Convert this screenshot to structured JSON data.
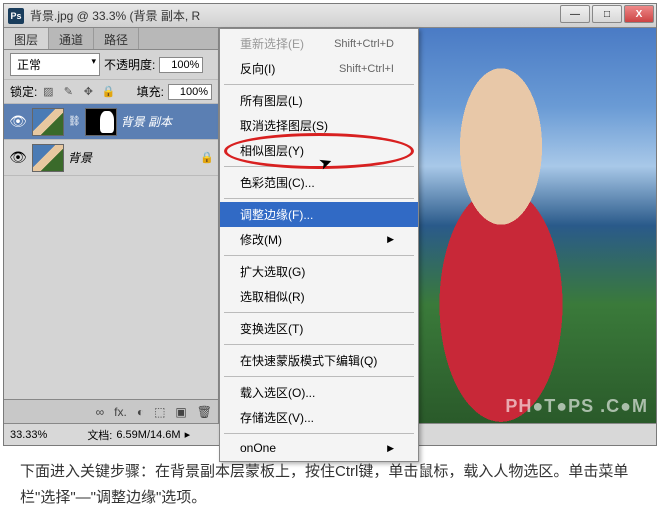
{
  "titlebar": {
    "ps_label": "Ps",
    "title": "背景.jpg @ 33.3% (背景 副本, R"
  },
  "win_controls": {
    "min": "—",
    "max": "□",
    "close": "X"
  },
  "panel": {
    "tabs": {
      "layers": "图层",
      "channels": "通道",
      "paths": "路径"
    },
    "blend_mode": "正常",
    "opacity_label": "不透明度:",
    "opacity_value": "100%",
    "lock_label": "锁定:",
    "fill_label": "填充:",
    "fill_value": "100%"
  },
  "layers": [
    {
      "name": "背景 副本",
      "visible": "👁"
    },
    {
      "name": "背景",
      "visible": "👁"
    }
  ],
  "panel_footer_icons": [
    "∞",
    "fx.",
    "◐",
    "⬚",
    "▣",
    "🗑"
  ],
  "menu": {
    "items": [
      {
        "label": "反向(I)",
        "shortcut": "Shift+Ctrl+I"
      },
      {
        "sep": true
      },
      {
        "label": "所有图层(L)"
      },
      {
        "label": "取消选择图层(S)"
      },
      {
        "label": "相似图层(Y)"
      },
      {
        "sep": true
      },
      {
        "label": "色彩范围(C)..."
      },
      {
        "sep": true
      },
      {
        "label": "调整边缘(F)...",
        "highlighted": true
      },
      {
        "label": "修改(M)",
        "submenu": true
      },
      {
        "sep": true
      },
      {
        "label": "扩大选取(G)"
      },
      {
        "label": "选取相似(R)"
      },
      {
        "sep": true
      },
      {
        "label": "变换选区(T)"
      },
      {
        "sep": true
      },
      {
        "label": "在快速蒙版模式下编辑(Q)"
      },
      {
        "sep": true
      },
      {
        "label": "载入选区(O)..."
      },
      {
        "label": "存储选区(V)..."
      },
      {
        "sep": true
      },
      {
        "label": "onOne",
        "submenu": true
      }
    ]
  },
  "status": {
    "zoom": "33.33%",
    "doc_label": "文档:",
    "doc_value": "6.59M/14.6M"
  },
  "watermark": "PH●T●PS .C●M",
  "caption": "下面进入关键步骤：在背景副本层蒙板上，按住Ctrl键，单击鼠标，载入人物选区。单击菜单栏\"选择\"—\"调整边缘\"选项。",
  "top_item_disabled": "重新选择(E)",
  "top_shortcut_disabled": "Shift+Ctrl+D"
}
